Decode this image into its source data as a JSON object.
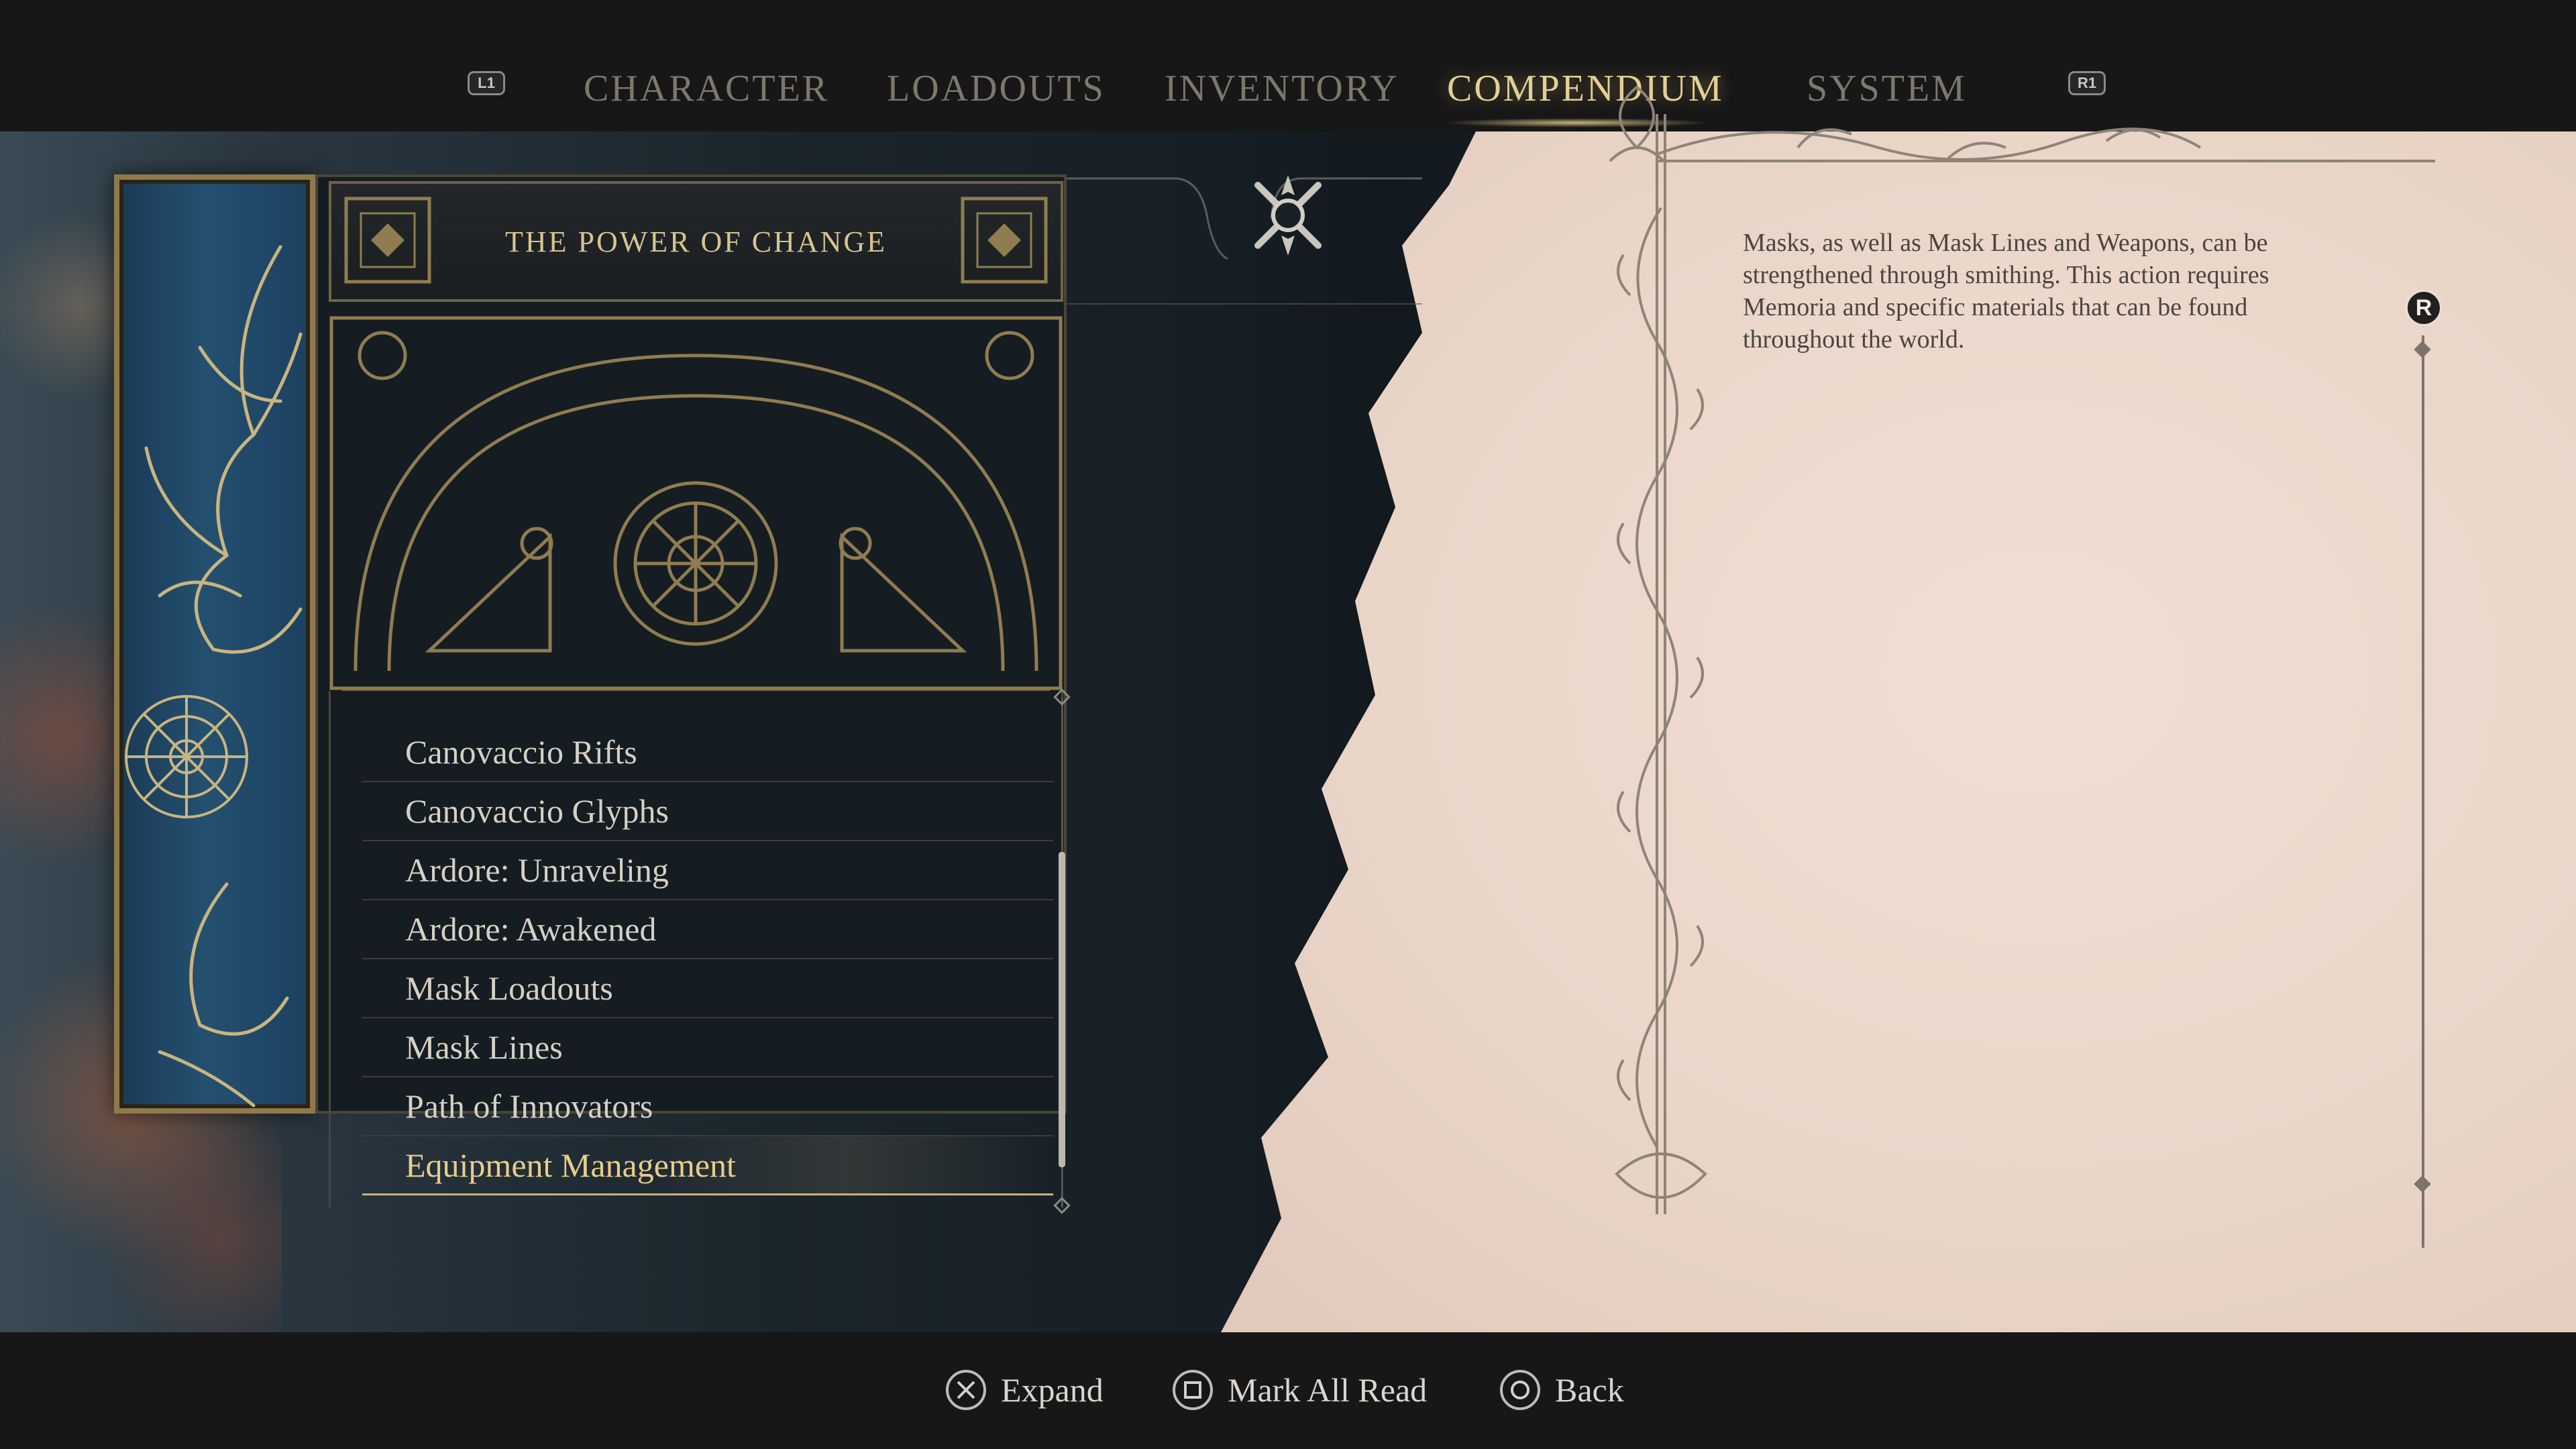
{
  "nav": {
    "left_shoulder": "L1",
    "right_shoulder": "R1",
    "tabs": [
      {
        "label": "CHARACTER"
      },
      {
        "label": "LOADOUTS"
      },
      {
        "label": "INVENTORY"
      },
      {
        "label": "COMPENDIUM",
        "active": true
      },
      {
        "label": "SYSTEM"
      }
    ]
  },
  "book": {
    "chapter_title": "THE POWER OF CHANGE",
    "entries": [
      {
        "label": "Canovaccio Rifts"
      },
      {
        "label": "Canovaccio Glyphs"
      },
      {
        "label": "Ardore: Unraveling"
      },
      {
        "label": "Ardore: Awakened"
      },
      {
        "label": "Mask Loadouts"
      },
      {
        "label": "Mask Lines"
      },
      {
        "label": "Path of Innovators"
      },
      {
        "label": "Equipment Management",
        "selected": true
      }
    ]
  },
  "description": {
    "text": "Masks, as well as Mask Lines and Weapons, can be strengthened through smithing. This action requires Memoria and specific materials that can be found throughout the world.",
    "scroll_button": "R"
  },
  "footer": {
    "hints": [
      {
        "icon": "cross-button-icon",
        "label": "Expand"
      },
      {
        "icon": "square-button-icon",
        "label": "Mark All Read"
      },
      {
        "icon": "circle-button-icon",
        "label": "Back"
      }
    ]
  },
  "colors": {
    "accent_gold": "#e4cf97",
    "parchment": "#ead6c9",
    "book_blue": "#245070"
  }
}
